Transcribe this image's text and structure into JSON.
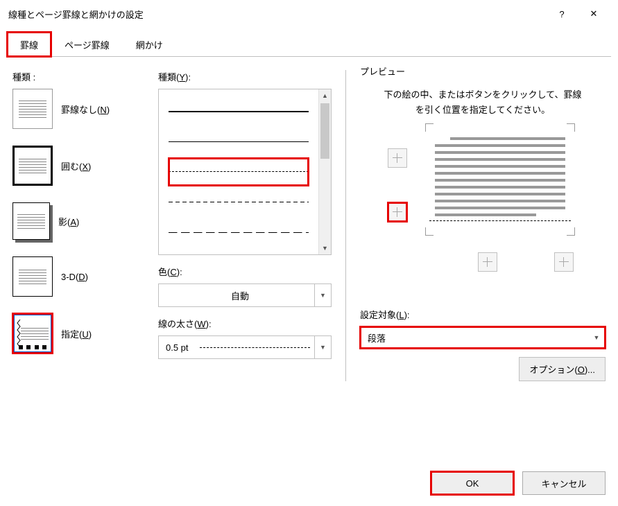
{
  "titlebar": {
    "title": "線種とページ罫線と網かけの設定",
    "help": "?",
    "close": "✕"
  },
  "tabs": {
    "t1": "罫線",
    "t2": "ページ罫線",
    "t3": "網かけ"
  },
  "col1": {
    "label": "種類 :",
    "items": {
      "none": "罫線なし(N)",
      "box": "囲む(X)",
      "shadow": "影(A)",
      "threeD": "3-D(D)",
      "custom": "指定(U)"
    }
  },
  "col2": {
    "style_label": "種類(Y):",
    "color_label": "色(C):",
    "color_value": "自動",
    "width_label": "線の太さ(W):",
    "width_value": "0.5 pt"
  },
  "col3": {
    "preview_label": "プレビュー",
    "hint": "下の絵の中、またはボタンをクリックして、罫線を引く位置を指定してください。",
    "apply_label": "設定対象(L):",
    "apply_value": "段落",
    "options": "オプション(O)..."
  },
  "buttons": {
    "ok": "OK",
    "cancel": "キャンセル"
  }
}
